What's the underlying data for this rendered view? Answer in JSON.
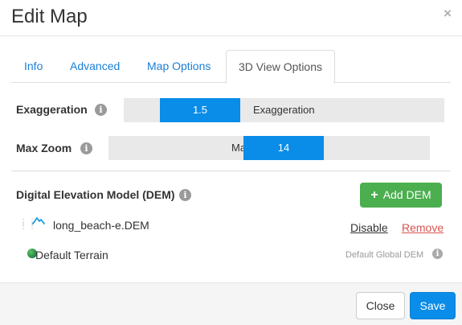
{
  "dialog": {
    "title": "Edit Map",
    "close_glyph": "×"
  },
  "tabs": [
    {
      "label": "Info",
      "active": false
    },
    {
      "label": "Advanced",
      "active": false
    },
    {
      "label": "Map Options",
      "active": false
    },
    {
      "label": "3D View Options",
      "active": true
    }
  ],
  "exaggeration": {
    "label": "Exaggeration",
    "info_icon": "info-icon",
    "value": "1.5",
    "track_text": "Exaggeration"
  },
  "max_zoom": {
    "label": "Max Zoom",
    "info_icon": "info-icon",
    "value": "14",
    "track_text": "Ma"
  },
  "dem": {
    "title": "Digital Elevation Model (DEM)",
    "info_icon": "info-icon",
    "add_button": {
      "plus": "+",
      "label": "Add DEM"
    },
    "items": [
      {
        "name": "long_beach-e.DEM",
        "icon": "mountain-icon",
        "actions": {
          "disable": "Disable",
          "remove": "Remove"
        }
      }
    ],
    "default": {
      "name": "Default Terrain",
      "icon": "globe-icon",
      "note": "Default Global DEM"
    }
  },
  "footer": {
    "close_label": "Close",
    "save_label": "Save"
  },
  "colors": {
    "primary": "#0a8ce9",
    "success": "#4bae4f",
    "danger": "#d9534f",
    "link": "#1a7fd6"
  }
}
